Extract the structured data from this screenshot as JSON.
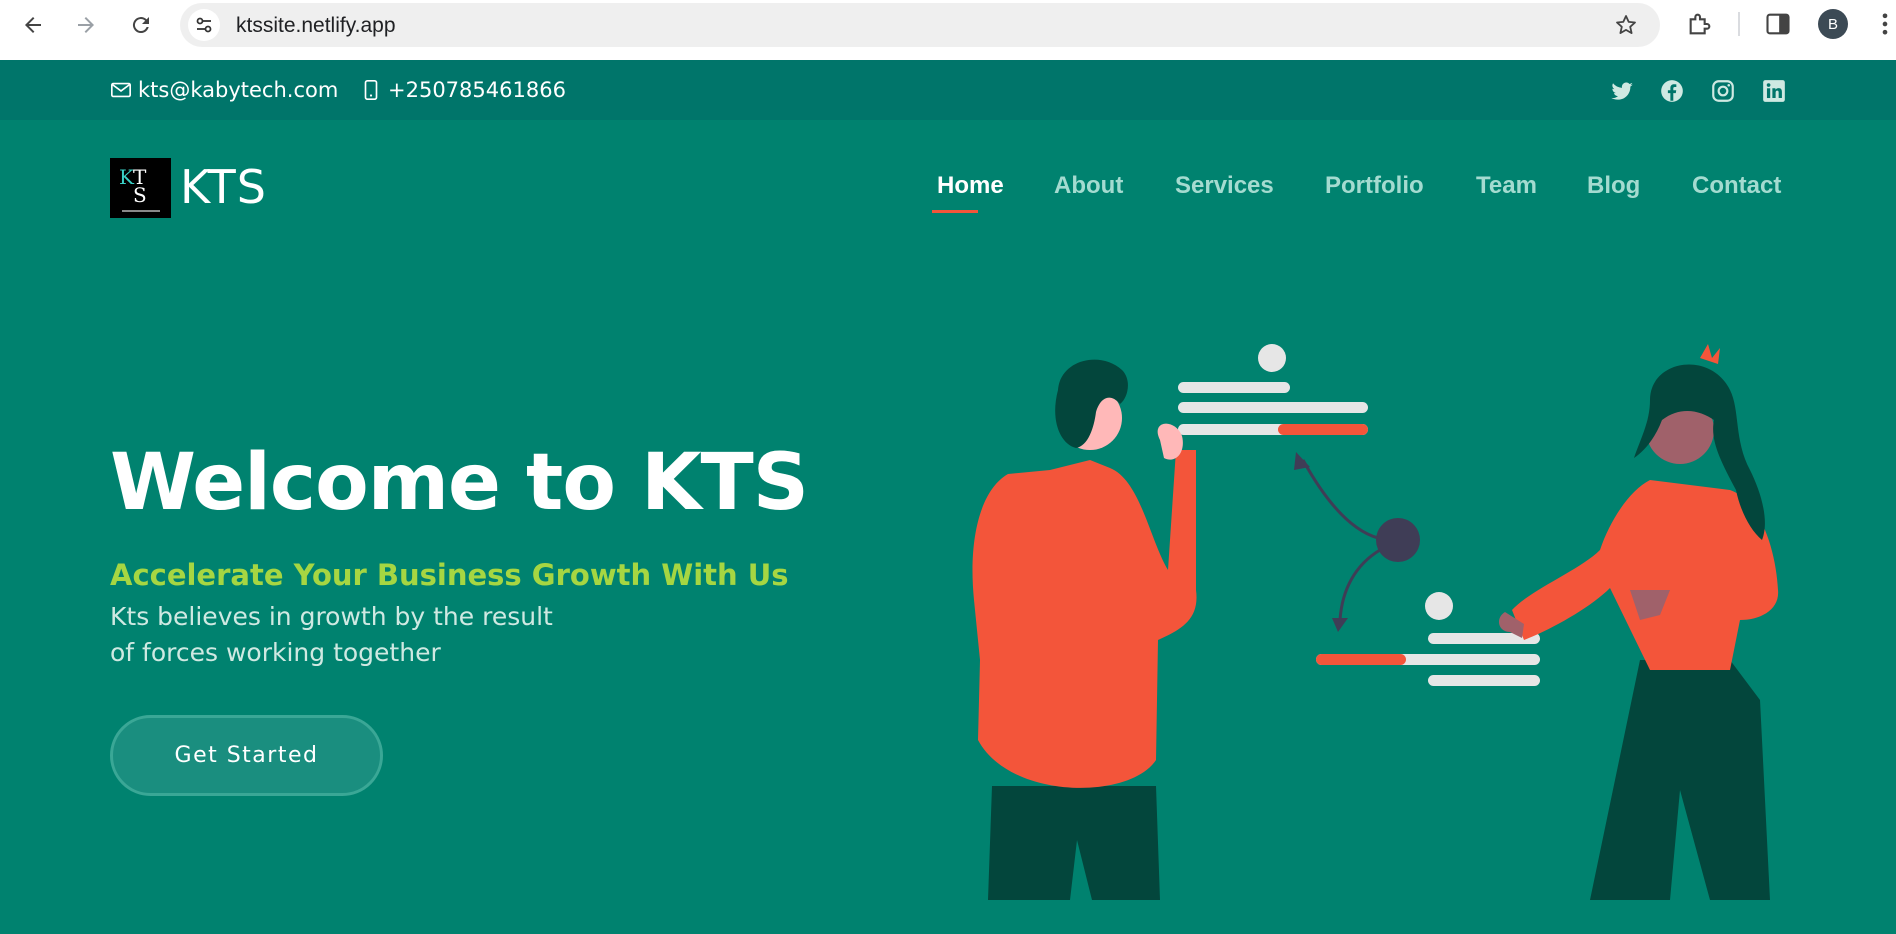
{
  "browser": {
    "url": "ktssite.netlify.app",
    "profile_initial": "B"
  },
  "topbar": {
    "email": "kts@kabytech.com",
    "phone": "+250785461866",
    "socials": [
      "twitter-icon",
      "facebook-icon",
      "instagram-icon",
      "linkedin-icon"
    ]
  },
  "header": {
    "logo_text": "KTS",
    "logo_letters": "KTS",
    "nav": [
      {
        "label": "Home",
        "active": true
      },
      {
        "label": "About",
        "active": false
      },
      {
        "label": "Services",
        "active": false
      },
      {
        "label": "Portfolio",
        "active": false
      },
      {
        "label": "Team",
        "active": false
      },
      {
        "label": "Blog",
        "active": false
      },
      {
        "label": "Contact",
        "active": false
      }
    ]
  },
  "hero": {
    "title": "Welcome to KTS",
    "subtitle": "Accelerate Your Business Growth With Us",
    "desc_line1": "Kts believes in growth by the result",
    "desc_line2": "of forces working together",
    "cta": "Get Started"
  },
  "colors": {
    "background": "#00826f",
    "topbar": "#00756a",
    "accent": "#f3553a",
    "subtitle": "#a6d642"
  }
}
